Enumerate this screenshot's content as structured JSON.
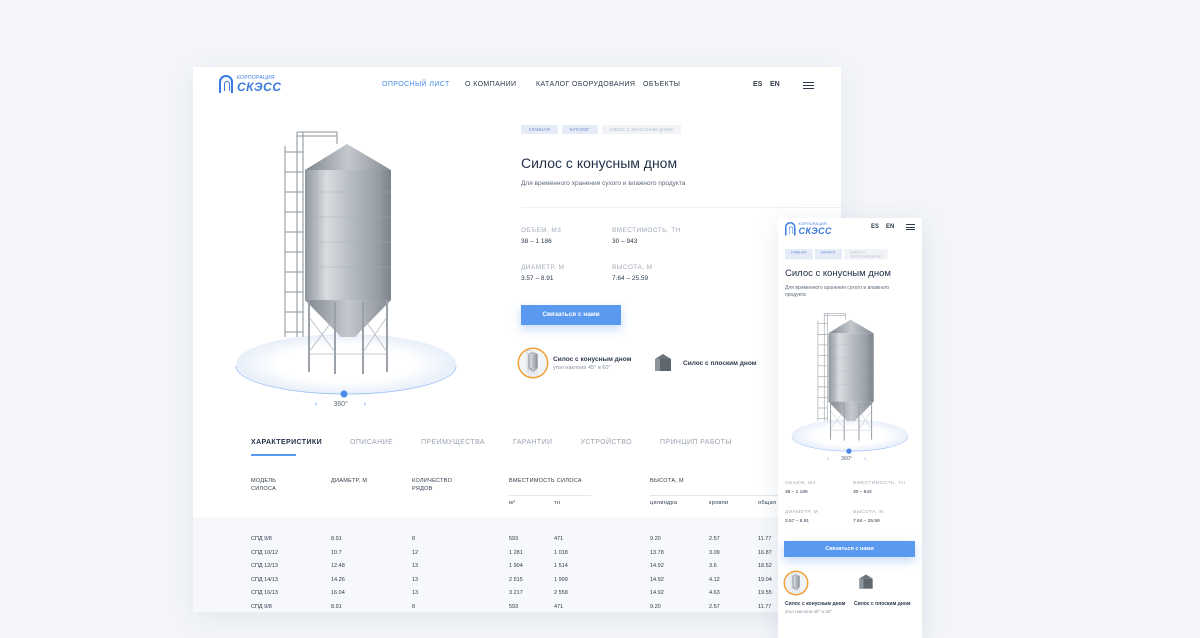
{
  "brand": {
    "line1": "КОРПОРАЦИЯ",
    "line2": "СКЭСС",
    "color": "#3b7ae0"
  },
  "nav": [
    {
      "label": "ОПРОСНЫЙ ЛИСТ",
      "active": true
    },
    {
      "label": "О КОМПАНИИ",
      "active": false
    },
    {
      "label": "КАТАЛОГ ОБОРУДОВАНИЯ",
      "active": false
    },
    {
      "label": "ОБЪЕКТЫ",
      "active": false
    }
  ],
  "languages": [
    "ES",
    "EN"
  ],
  "breadcrumbs": [
    "ГЛАВНАЯ",
    "КАТАЛОГ",
    "СИЛОС С КОНУСНЫМ ДНОМ"
  ],
  "product": {
    "title": "Силос с конусным дном",
    "subtitle": "Для временного хранения сухого и влажного продукта",
    "specs": [
      {
        "label": "ОБЪЕМ, М3",
        "value": "38 – 1 186"
      },
      {
        "label": "ВМЕСТИМОСТЬ, ТН",
        "value": "30 – 943"
      },
      {
        "label": "ДИАМЕТР, М",
        "value": "3.57 – 8.91"
      },
      {
        "label": "ВЫСОТА, М",
        "value": "7.64 – 25.59"
      }
    ],
    "cta": "Связаться с нами",
    "rotation": "360°",
    "variants": [
      {
        "title": "Силос с конусным дном",
        "sub": "угол наклона 45° и 60°",
        "selected": true
      },
      {
        "title": "Силос с плоским дном",
        "sub": "",
        "selected": false
      }
    ]
  },
  "mobile_variants": [
    {
      "title": "Силос с конусным дном",
      "sub": "угол наклона 45° и 60°"
    },
    {
      "title": "Силос с плоским дном",
      "sub": ""
    }
  ],
  "tabs": [
    {
      "label": "ХАРАКТЕРИСТИКИ",
      "active": true
    },
    {
      "label": "ОПИСАНИЕ",
      "active": false
    },
    {
      "label": "ПРЕИМУЩЕСТВА",
      "active": false
    },
    {
      "label": "ГАРАНТИИ",
      "active": false
    },
    {
      "label": "УСТРОЙСТВО",
      "active": false
    },
    {
      "label": "ПРИНЦИП РАБОТЫ",
      "active": false
    }
  ],
  "table": {
    "head": {
      "model": "МОДЕЛЬ\nСИЛОСА",
      "diameter": "ДИАМЕТР, М",
      "rows": "КОЛИЧЕСТВО\nРЯДОВ",
      "capacity": "ВМЕСТИМОСТЬ СИЛОСА",
      "height": "ВЫСОТА, М",
      "sub": [
        "м³",
        "тн",
        "цилиндра",
        "кровли",
        "общая"
      ]
    },
    "rows": [
      [
        "СПД 9/8",
        "8.91",
        "8",
        "593",
        "471",
        "9.20",
        "2.57",
        "11.77"
      ],
      [
        "СПД 10/12",
        "10.7",
        "12",
        "1 281",
        "1 018",
        "13.78",
        "3.09",
        "16.87"
      ],
      [
        "СПД 12/13",
        "12.48",
        "13",
        "1 904",
        "1 514",
        "14.92",
        "3.6",
        "18.52"
      ],
      [
        "СПД 14/13",
        "14.26",
        "13",
        "2 515",
        "1 999",
        "14.92",
        "4.12",
        "19.04"
      ],
      [
        "СПД 16/13",
        "16.04",
        "13",
        "3 217",
        "2 558",
        "14.92",
        "4.63",
        "19.55"
      ],
      [
        "СПД 9/8",
        "8.91",
        "8",
        "593",
        "471",
        "9.20",
        "2.57",
        "11.77"
      ]
    ]
  },
  "colors": {
    "accent": "#5a99f0",
    "selected_ring": "#f2a13a",
    "text": "#2d3a4b"
  }
}
